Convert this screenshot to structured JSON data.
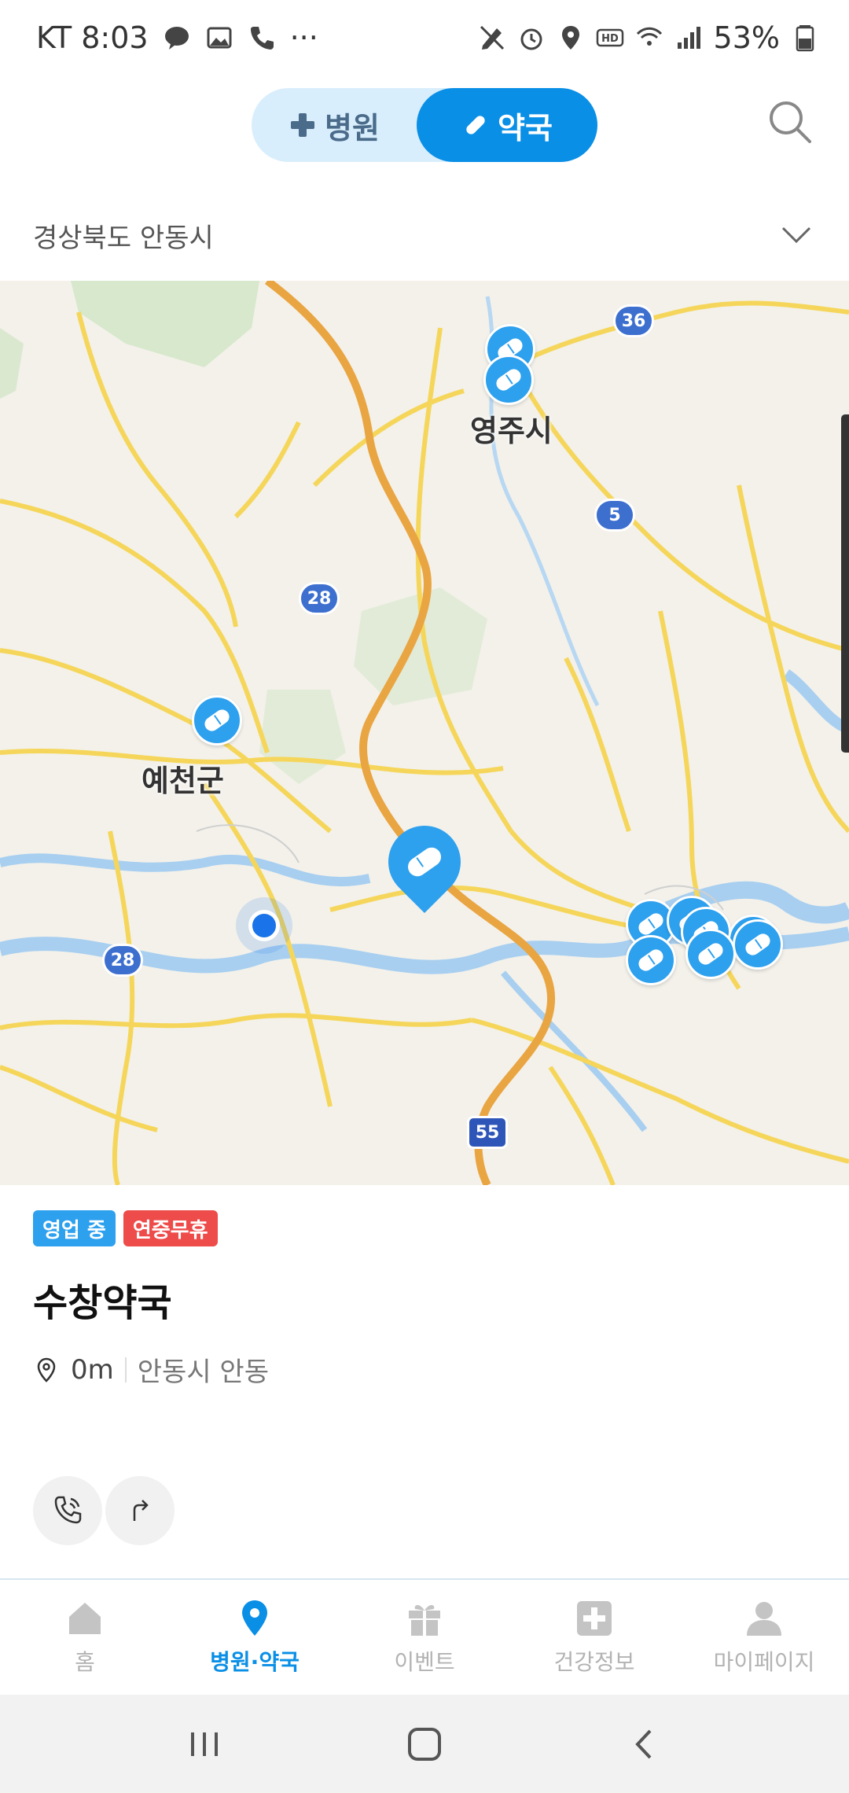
{
  "status_bar": {
    "carrier_time": "KT 8:03",
    "extra": "···",
    "battery": "53%"
  },
  "header": {
    "tab_hospital": "병원",
    "tab_pharmacy": "약국",
    "active_tab": "pharmacy"
  },
  "region": {
    "selected": "경상북도 안동시"
  },
  "map": {
    "labels": {
      "yeongju": "영주시",
      "yecheon": "예천군"
    },
    "highway_numbers": [
      "36",
      "5",
      "28",
      "28",
      "55"
    ],
    "pin_color": "#2da0ee"
  },
  "place": {
    "badge_open": "영업 중",
    "badge_holiday": "연중무휴",
    "name": "수창약국",
    "distance": "0m",
    "address": "안동시 안동"
  },
  "bottom_nav": {
    "items": [
      {
        "label": "홈",
        "icon": "home-icon"
      },
      {
        "label": "병원·약국",
        "icon": "location-pin-icon"
      },
      {
        "label": "이벤트",
        "icon": "gift-icon"
      },
      {
        "label": "건강정보",
        "icon": "medical-cross-icon"
      },
      {
        "label": "마이페이지",
        "icon": "person-icon"
      }
    ],
    "active_index": 1
  }
}
